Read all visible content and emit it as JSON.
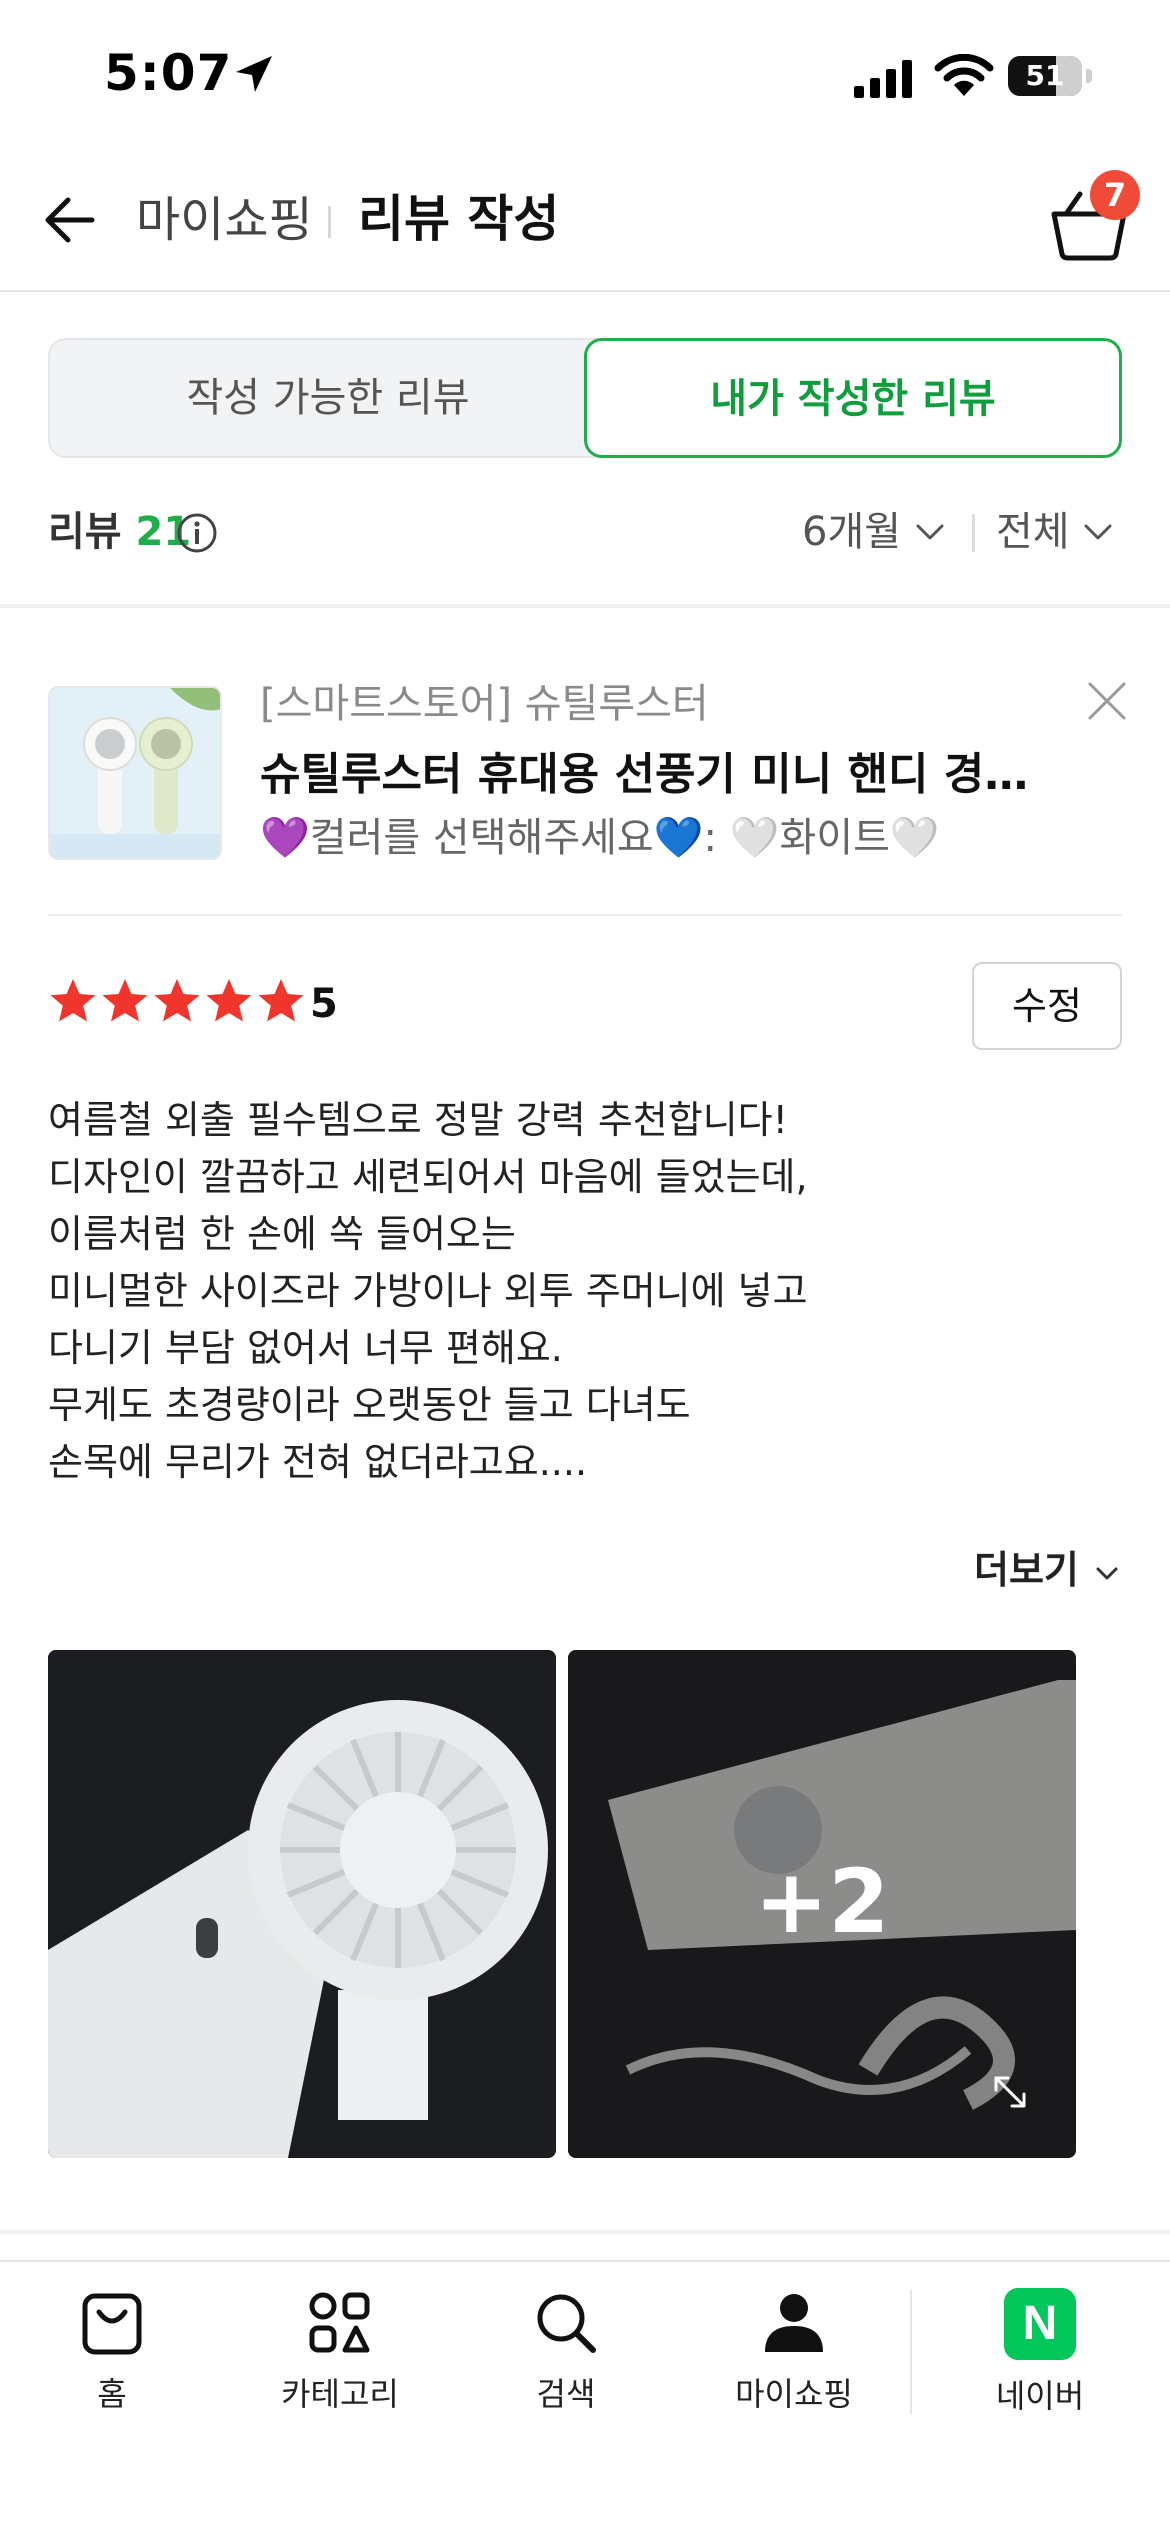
{
  "status_bar": {
    "time": "5:07",
    "battery": "51"
  },
  "header": {
    "parent": "마이쇼핑",
    "title": "리뷰 작성",
    "cart_badge": "7"
  },
  "tabs": [
    {
      "label": "작성 가능한 리뷰",
      "selected": false
    },
    {
      "label": "내가 작성한 리뷰",
      "selected": true
    }
  ],
  "summary": {
    "label": "리뷰",
    "count": "21",
    "period_filter": "6개월",
    "type_filter": "전체"
  },
  "review": {
    "store": "[스마트스토어] 슈틸루스터",
    "product_name": "슈틸루스터 휴대용 선풍기 미니 핸디 경량 …",
    "option": "💜컬러를 선택해주세요💙: 🤍화이트🤍",
    "rating": "5",
    "edit_label": "수정",
    "lines": [
      "여름철 외출 필수템으로 정말 강력 추천합니다!",
      "디자인이 깔끔하고 세련되어서 마음에 들었는데,",
      "이름처럼 한 손에 쏙 들어오는",
      "미니멀한 사이즈라 가방이나 외투 주머니에 넣고",
      "다니기 부담 없어서 너무 편해요.",
      "무게도 초경량이라 오랫동안 들고 다녀도",
      "손목에 무리가 전혀 없더라고요...."
    ],
    "more_label": "더보기",
    "extra_photos": "+2"
  },
  "bottom_nav": [
    {
      "label": "홈",
      "icon": "shopping-bag-icon"
    },
    {
      "label": "카테고리",
      "icon": "category-grid-icon"
    },
    {
      "label": "검색",
      "icon": "search-icon"
    },
    {
      "label": "마이쇼핑",
      "icon": "person-icon"
    },
    {
      "label": "네이버",
      "icon": "naver-logo-icon"
    }
  ],
  "colors": {
    "accent_green": "#1fae4a",
    "star_red": "#f0362c",
    "badge_red": "#f04b38",
    "naver_green": "#03c75a"
  }
}
